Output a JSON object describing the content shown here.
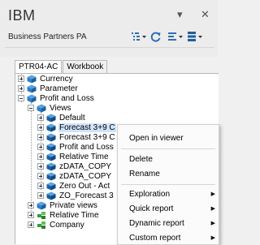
{
  "header": {
    "brand": "IBM",
    "subtitle": "Business Partners PA",
    "window_controls": {
      "dropdown": "▾",
      "close": "✕"
    },
    "toolbar": [
      {
        "name": "view-options-icon"
      },
      {
        "name": "refresh-icon"
      },
      {
        "name": "filter-options-icon"
      },
      {
        "name": "settings-icon"
      }
    ]
  },
  "tabs": [
    {
      "label": "PTR04-AC",
      "active": true
    },
    {
      "label": "Workbook",
      "active": false
    }
  ],
  "tree": [
    {
      "label": "Currency",
      "icon": "cube",
      "level": 0,
      "expander": "plus"
    },
    {
      "label": "Parameter",
      "icon": "cube",
      "level": 0,
      "expander": "plus"
    },
    {
      "label": "Profit and Loss",
      "icon": "cube",
      "level": 0,
      "expander": "minus"
    },
    {
      "label": "Views",
      "icon": "cube",
      "level": 1,
      "expander": "minus"
    },
    {
      "label": "Default",
      "icon": "view",
      "level": 2,
      "expander": "plus"
    },
    {
      "label": "Forecast 3+9 C",
      "icon": "view",
      "level": 2,
      "expander": "plus",
      "selected": true
    },
    {
      "label": "Forecast 3+9 C",
      "icon": "view",
      "level": 2,
      "expander": "plus"
    },
    {
      "label": "Profit and Loss",
      "icon": "view",
      "level": 2,
      "expander": "plus"
    },
    {
      "label": "Relative Time",
      "icon": "view",
      "level": 2,
      "expander": "plus"
    },
    {
      "label": "zDATA_COPY",
      "icon": "view",
      "level": 2,
      "expander": "plus"
    },
    {
      "label": "zDATA_COPY",
      "icon": "view",
      "level": 2,
      "expander": "plus"
    },
    {
      "label": "Zero Out - Act",
      "icon": "view",
      "level": 2,
      "expander": "plus"
    },
    {
      "label": "ZO_Forecast 3",
      "icon": "view",
      "level": 2,
      "expander": "plus"
    },
    {
      "label": "Private views",
      "icon": "cube",
      "level": 1,
      "expander": "plus"
    },
    {
      "label": "Relative Time",
      "icon": "dimension",
      "level": 1,
      "expander": "plus"
    },
    {
      "label": "Company",
      "icon": "dimension",
      "level": 1,
      "expander": "plus"
    }
  ],
  "context_menu": [
    {
      "label": "Open in viewer",
      "submenu": false
    },
    {
      "separator": true
    },
    {
      "label": "Delete",
      "submenu": false
    },
    {
      "label": "Rename",
      "submenu": false
    },
    {
      "separator": true
    },
    {
      "label": "Exploration",
      "submenu": true
    },
    {
      "label": "Quick report",
      "submenu": true
    },
    {
      "label": "Dynamic report",
      "submenu": true
    },
    {
      "label": "Custom report",
      "submenu": true
    }
  ],
  "colors": {
    "cube_blue": "#2f7fc9",
    "view_blue": "#1c5f9e",
    "dimension_green": "#3a9a3a",
    "selection": "#cfe3fb"
  }
}
